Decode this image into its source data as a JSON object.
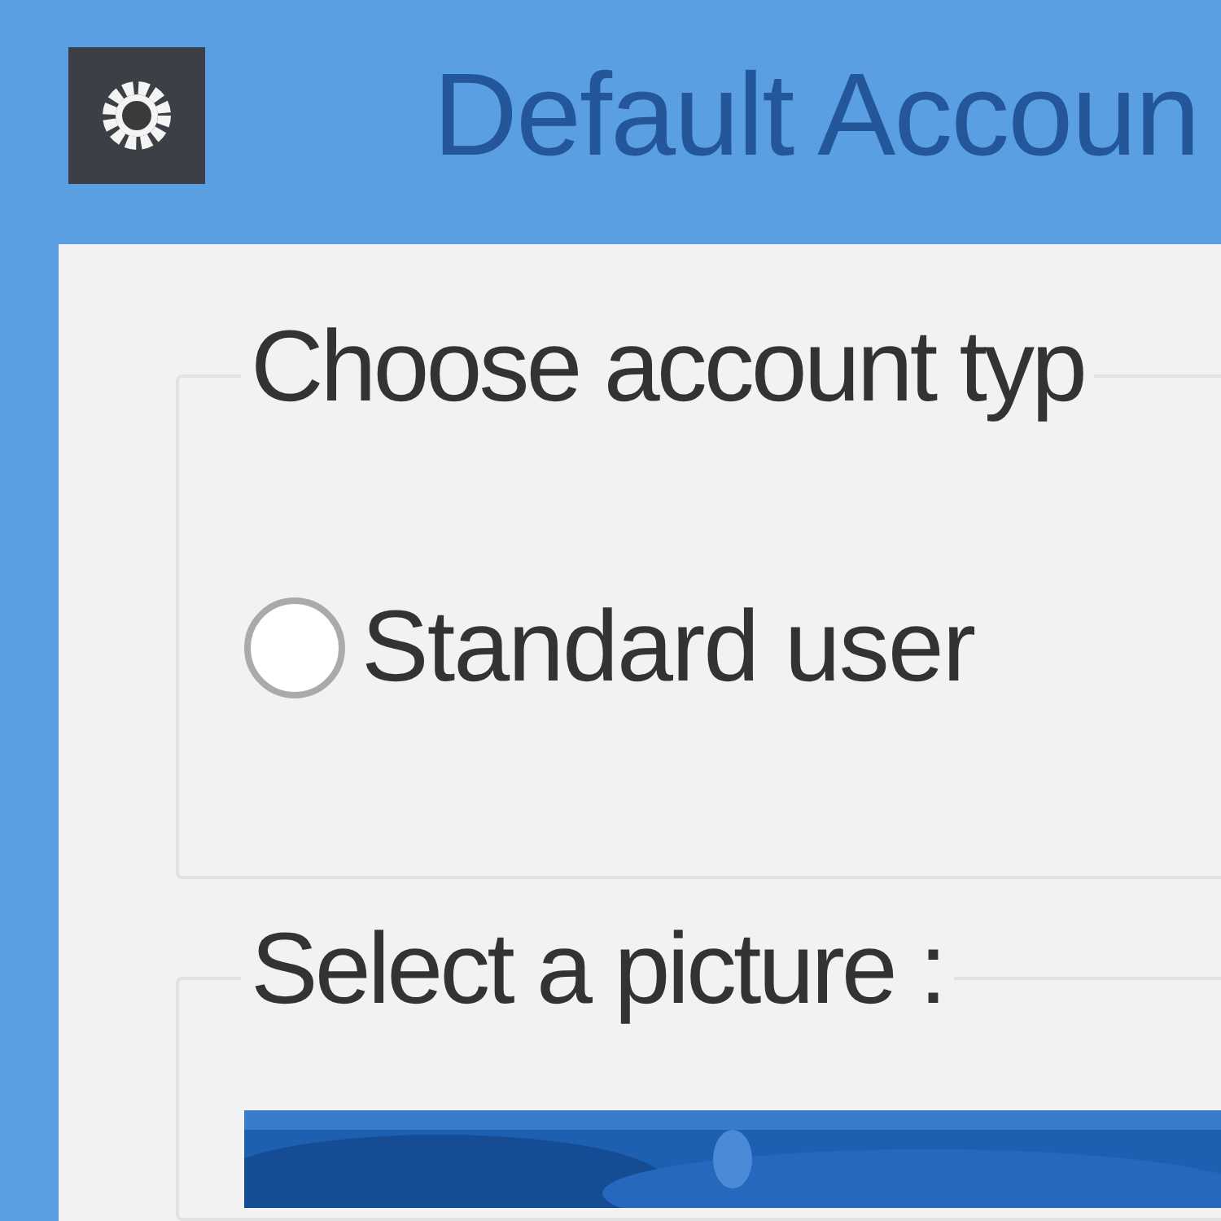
{
  "window": {
    "title": "Default Accoun"
  },
  "account_type": {
    "legend": "Choose account typ",
    "options": [
      {
        "label": "Standard user",
        "selected": false
      }
    ]
  },
  "picture_group": {
    "legend": "Select a picture :"
  }
}
